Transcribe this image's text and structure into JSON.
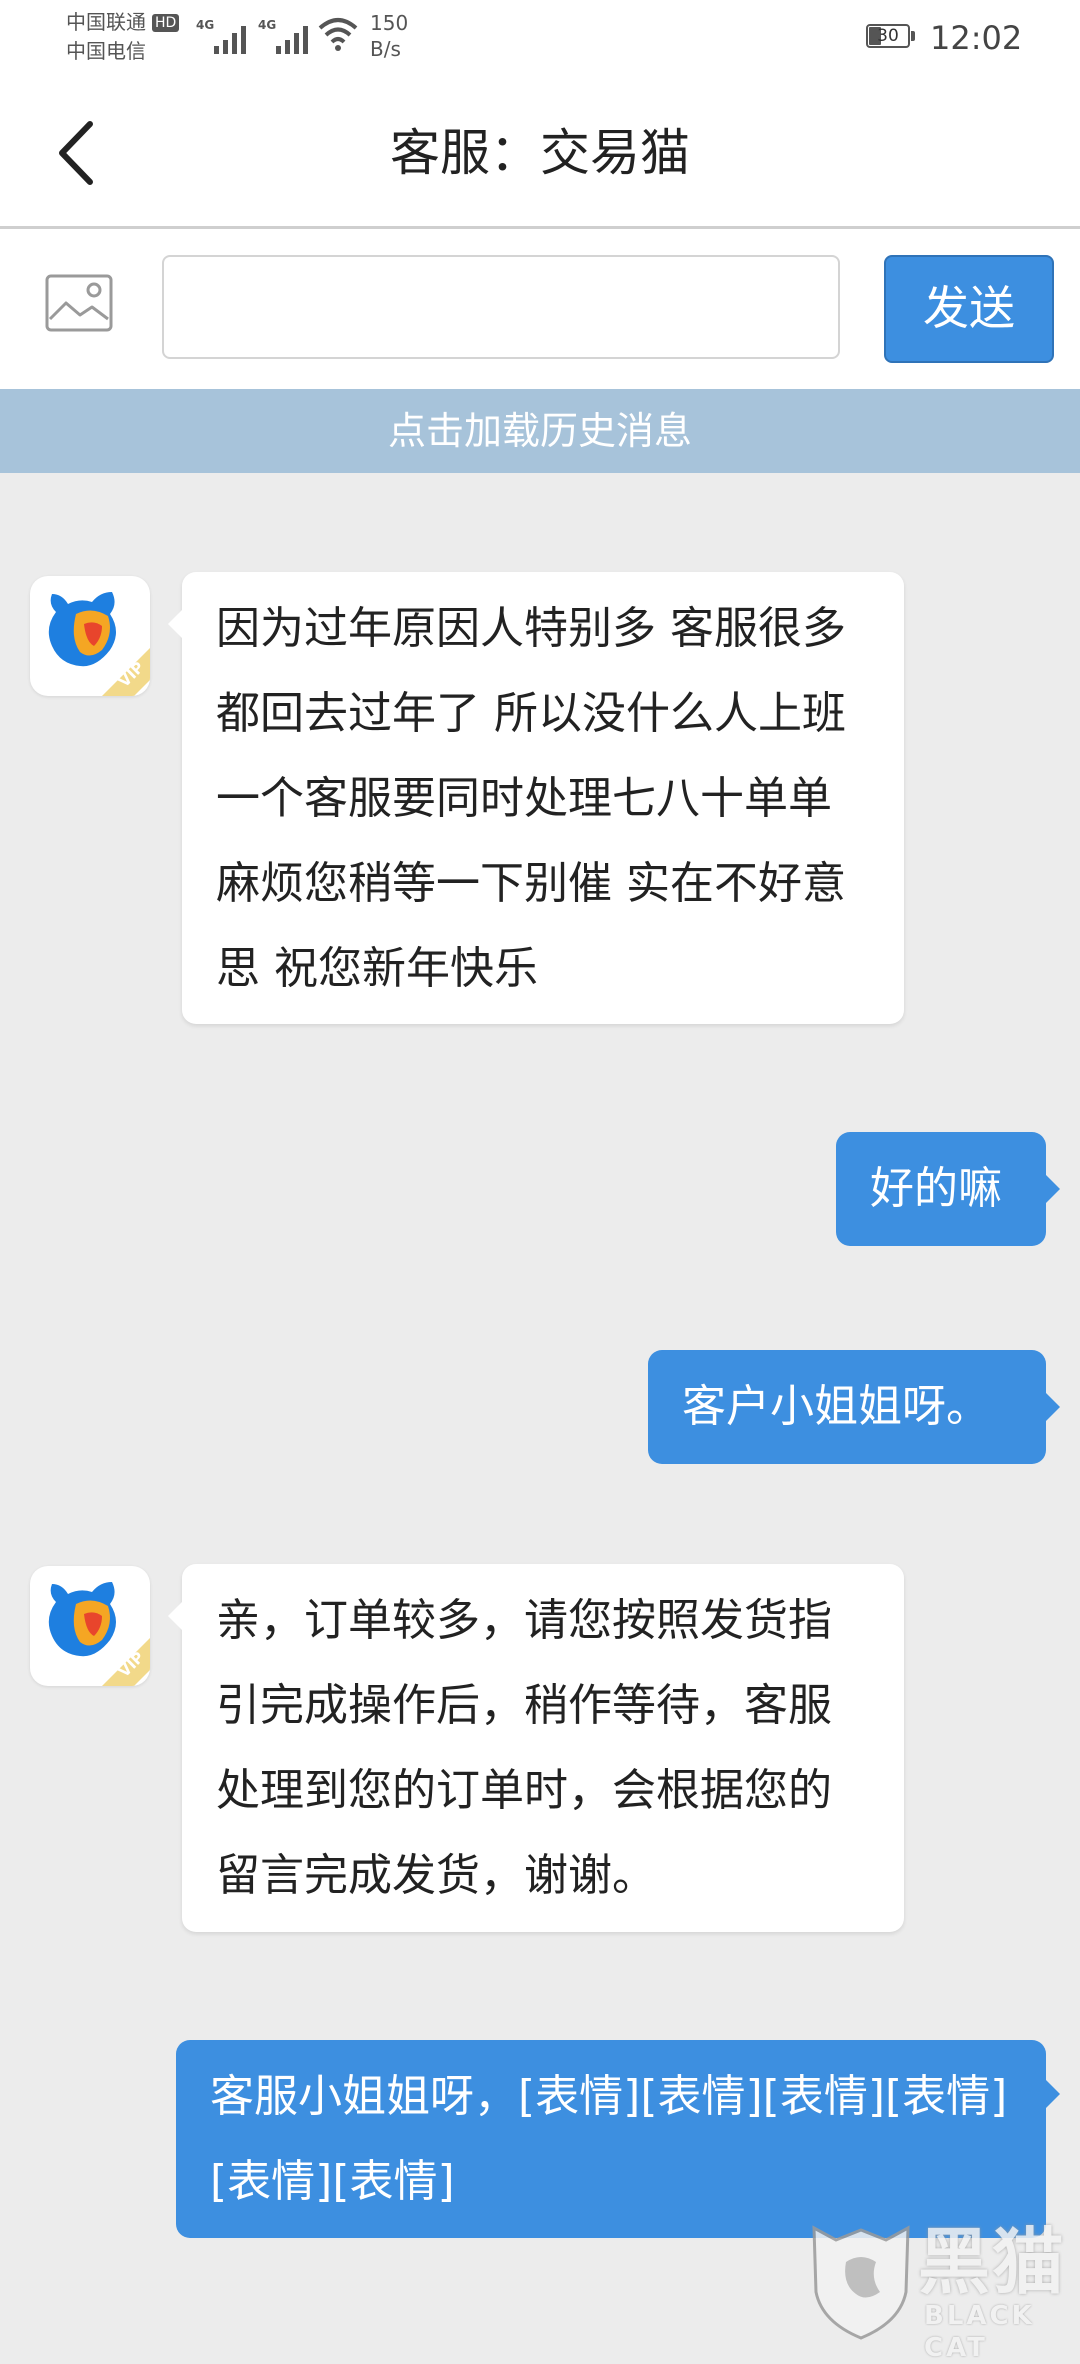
{
  "status_bar": {
    "carrier_1": "中国联通",
    "hd_badge": "HD",
    "carrier_2": "中国电信",
    "signal_1_label": "4G",
    "signal_2_label": "4G",
    "net_speed_value": "150",
    "net_speed_unit": "B/s",
    "battery_level": "30",
    "time": "12:02"
  },
  "header": {
    "back_icon": "chevron-left-icon",
    "title": "客服：交易猫"
  },
  "composer": {
    "image_icon": "image-icon",
    "input_value": "",
    "send_label": "发送"
  },
  "load_history_label": "点击加载历史消息",
  "messages": [
    {
      "side": "left",
      "text": "因为过年原因人特别多 客服很多都回去过年了 所以没什么人上班 一个客服要同时处理七八十单单 麻烦您稍等一下别催 实在不好意思 祝您新年快乐"
    },
    {
      "side": "right",
      "text": "好的嘛"
    },
    {
      "side": "right",
      "text": "客户小姐姐呀。"
    },
    {
      "side": "left",
      "text": "亲，订单较多，请您按照发货指引完成操作后，稍作等待，客服处理到您的订单时，会根据您的留言完成发货，谢谢。"
    },
    {
      "side": "right",
      "text": "客服小姐姐呀，[表情][表情][表情][表情][表情][表情]"
    }
  ],
  "avatar_badge": "VIP",
  "watermark": {
    "text_cn": "黑猫",
    "text_en": "BLACK CAT"
  },
  "colors": {
    "accent_blue": "#3d8fe0",
    "history_bar": "#a7c3da",
    "chat_background": "#ececec"
  }
}
